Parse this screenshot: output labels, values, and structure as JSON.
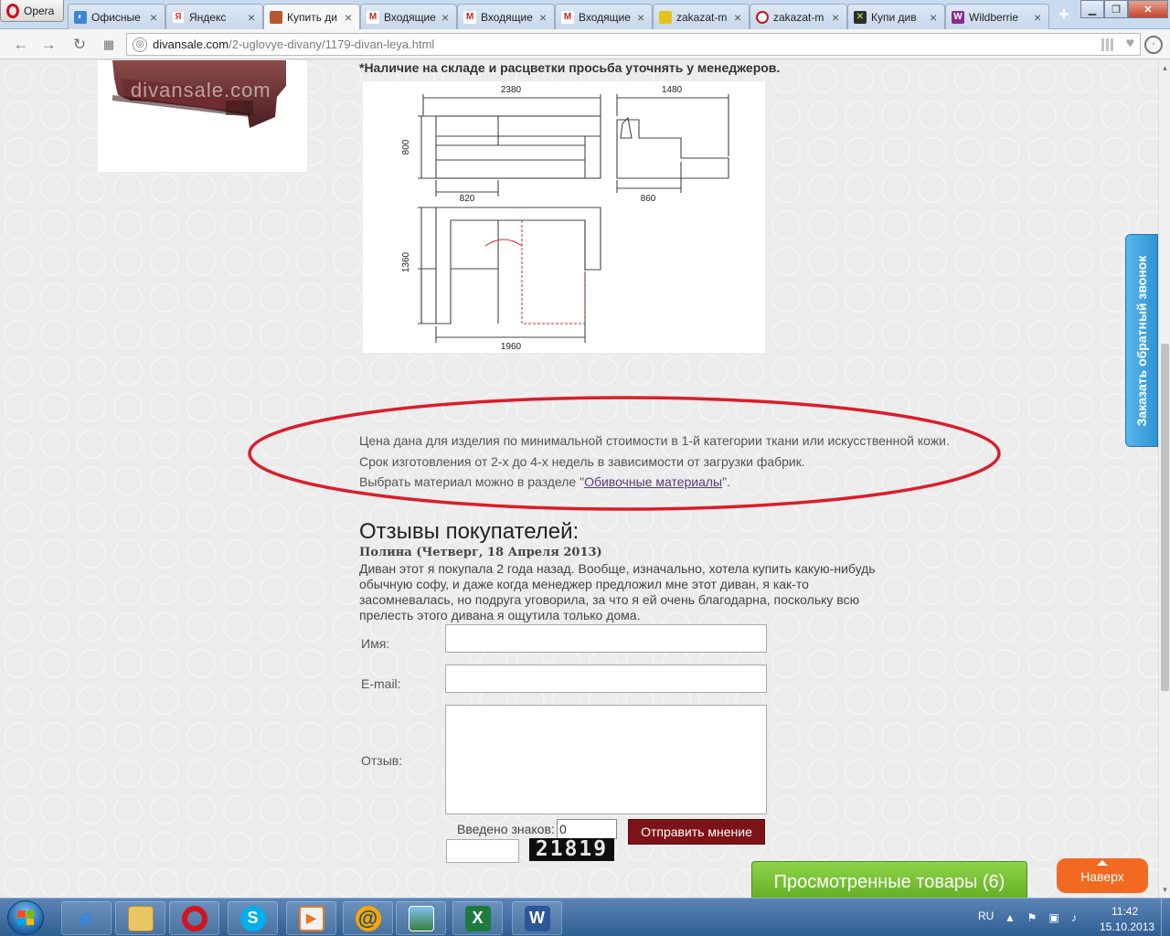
{
  "browser": {
    "menu_label": "Opera",
    "tabs": [
      {
        "label": "Офисные",
        "icon": "office-tab-icon",
        "color": "#3a86d6"
      },
      {
        "label": "Яндекс",
        "icon": "yandex-icon",
        "color": "#e33"
      },
      {
        "label": "Купить ди",
        "icon": "sofa-favicon-icon",
        "color": "#b5582d",
        "active": true
      },
      {
        "label": "Входящие",
        "icon": "gmail-icon",
        "color": "#c5221f"
      },
      {
        "label": "Входящие",
        "icon": "gmail-icon",
        "color": "#c5221f"
      },
      {
        "label": "Входящие",
        "icon": "gmail-icon",
        "color": "#c5221f"
      },
      {
        "label": "zakazat-m",
        "icon": "zakazat-icon",
        "color": "#e3c21a"
      },
      {
        "label": "zakazat-m",
        "icon": "zakazat-opera-icon",
        "color": "#cc0f16"
      },
      {
        "label": "Купи див",
        "icon": "kupi-divan-icon",
        "color": "#2d2d2d"
      },
      {
        "label": "Wildberrie",
        "icon": "wildberries-icon",
        "color": "#8b2a8e"
      }
    ],
    "url_host": "divansale.com",
    "url_path": "/2-uglovye-divany/1179-divan-leya.html"
  },
  "page": {
    "watermark": "divansale.com",
    "stock_note": "*Наличие на складе и расцветки просьба уточнять у менеджеров.",
    "schema_dims": {
      "top_width": "2380",
      "side_width": "1480",
      "height": "800",
      "seat": "820",
      "side_depth": "860",
      "corner_depth": "1360",
      "corner_width": "1960"
    },
    "price_lines": [
      "Цена дана для изделия по минимальной стоимости в 1-й категории ткани или искусственной кожи.",
      "Срок изготовления от 2-х до 4-х недель в зависимости от загрузки фабрик."
    ],
    "material_prefix": "Выбрать материал можно в разделе \"",
    "material_link": "Обивочные материалы",
    "material_suffix": "\".",
    "reviews_title": "Отзывы покупателей:",
    "review_author": "Полина  (Четверг, 18 Апреля 2013)",
    "review_text": "Диван этот я покупала 2 года назад. Вообще, изначально, хотела купить какую-нибудь обычную софу, и даже когда менеджер предложил мне этот диван, я как-то засомневалась, но подруга уговорила, за что я ей очень благодарна, поскольку всю прелесть этого дивана я ощутила только дома.",
    "form": {
      "name_label": "Имя:",
      "email_label": "E-mail:",
      "review_label": "Отзыв:",
      "chars_label": "Введено знаков:",
      "chars_value": "0",
      "captcha_code": "21819",
      "submit_label": "Отправить мнение"
    },
    "viewed_products": "Просмотренные товары (6)",
    "to_top": "Наверх",
    "callback": "Заказать обратный звонок"
  },
  "taskbar": {
    "apps": [
      "internet-explorer-icon",
      "file-explorer-icon",
      "opera-icon",
      "skype-icon",
      "media-player-icon",
      "mail-agent-icon",
      "photo-viewer-icon",
      "excel-icon",
      "word-icon"
    ],
    "lang": "RU",
    "time": "11:42",
    "date": "15.10.2013"
  },
  "colors": {
    "accent_red": "#d91e2a",
    "button_dark_red": "#7d1316",
    "green": "#6cbb2c",
    "orange": "#f26a21",
    "blue": "#3aa3e3"
  }
}
